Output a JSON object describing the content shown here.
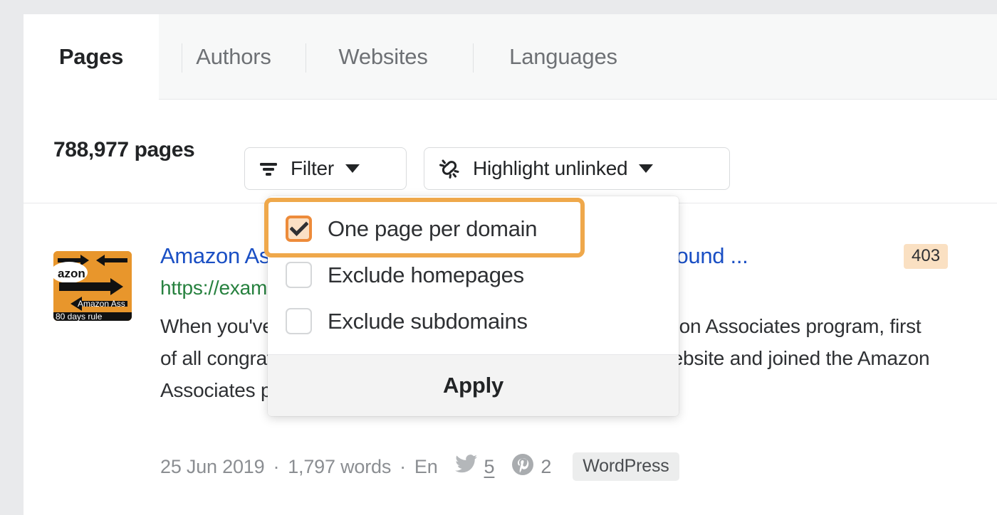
{
  "tabs": [
    {
      "label": "Pages",
      "active": true
    },
    {
      "label": "Authors",
      "active": false
    },
    {
      "label": "Websites",
      "active": false
    },
    {
      "label": "Languages",
      "active": false
    }
  ],
  "toolbar": {
    "page_count": "788,977 pages",
    "filter_label": "Filter",
    "filter_icon": "filter-icon",
    "highlight_label": "Highlight unlinked",
    "highlight_icon": "broken-link-icon",
    "caret_icon": "chevron-down-icon"
  },
  "dropdown": {
    "options": [
      {
        "label": "One page per domain",
        "checked": true
      },
      {
        "label": "Exclude homepages",
        "checked": false
      },
      {
        "label": "Exclude subdomains",
        "checked": false
      }
    ],
    "apply_label": "Apply"
  },
  "result": {
    "thumbnail": {
      "alt": "amazon-associates-180-days-rule-thumbnail",
      "text_top": "azon",
      "text_mid": "Amazon Ass",
      "text_bottom": "80 days rule"
    },
    "title": "Amazon Associates 180 Days Rule: 3 Ways To Get Around ...",
    "status_badge": "403",
    "url": "https://example.com/amazon-associates-180-days",
    "url_caret_icon": "chevron-down-icon",
    "snippet": "When you've just created your website and joined the Amazon Associates program, first of all congratulations on... When you've just created your website and joined the Amazon Associates program, first of all congratulations on your",
    "meta": {
      "date": "25 Jun 2019",
      "separator": "·",
      "words": "1,797 words",
      "language": "En",
      "twitter_icon": "twitter-icon",
      "twitter_count": "5",
      "pinterest_icon": "pinterest-icon",
      "pinterest_count": "2",
      "platform": "WordPress"
    }
  },
  "colors": {
    "accent_orange": "#ed8b3a",
    "highlight_border": "#efa84b",
    "checkbox_fill": "#fae0c4",
    "link_blue": "#1a4fc4",
    "url_green": "#27813f",
    "badge_bg": "#fae0c2",
    "page_bg": "#e9eaec"
  }
}
